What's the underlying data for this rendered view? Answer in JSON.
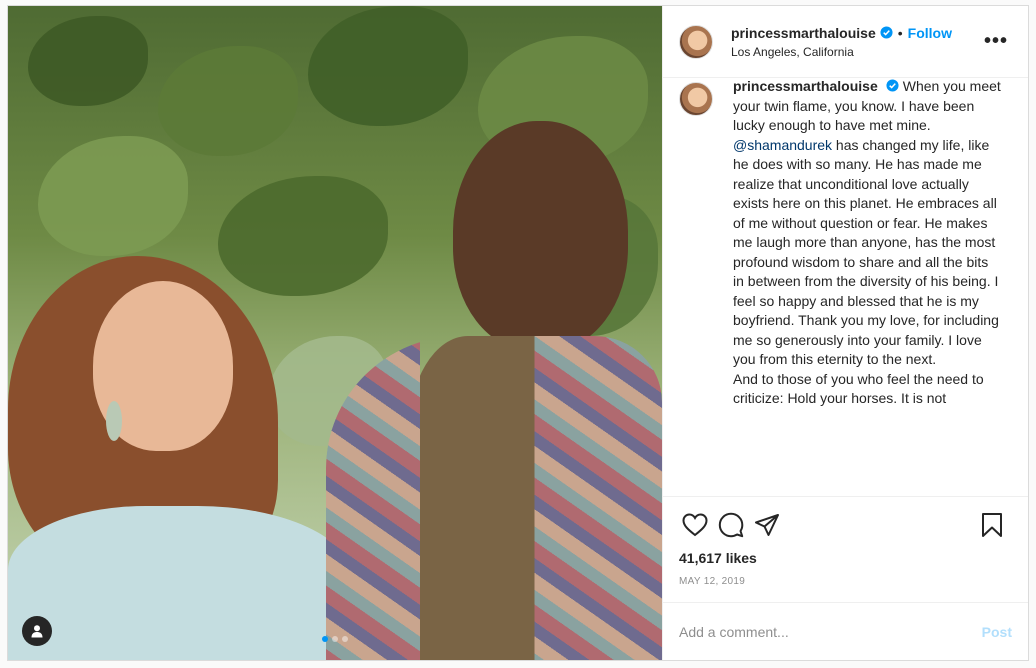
{
  "post": {
    "username": "princessmarthalouise",
    "follow_label": "Follow",
    "separator": "•",
    "location": "Los Angeles, California",
    "more_label": "•••",
    "caption_before_mention": "When you meet your twin flame, you know. I have been lucky enough to have met mine. ",
    "mention": "@shamandurek",
    "caption_after_mention": " has changed my life, like he does with so many. He has made me realize that unconditional love actually exists here on this planet. He embraces all of me without question or fear. He makes me laugh more than anyone, has the most profound wisdom to share and all the bits in between from the diversity of his being. I feel so happy and blessed that he is my boyfriend. Thank you my love, for including me so generously into your family. I love you from this eternity to the next.\nAnd to those of you who feel the need to criticize: Hold your horses. It is not",
    "likes": "41,617 likes",
    "date": "MAY 12, 2019"
  },
  "comment": {
    "placeholder": "Add a comment...",
    "post_label": "Post"
  },
  "colors": {
    "accent": "#0095f6",
    "post_disabled": "#b2dffc",
    "muted": "#8e8e8e"
  },
  "icons": {
    "like": "heart-icon",
    "comment": "comment-icon",
    "share": "share-icon",
    "save": "bookmark-icon",
    "verified": "verified-badge-icon",
    "tags": "user-tag-icon"
  }
}
